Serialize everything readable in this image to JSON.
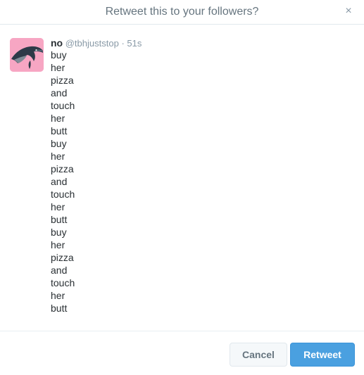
{
  "dialog": {
    "title": "Retweet this to your followers?",
    "close_icon": "×"
  },
  "tweet": {
    "fullname": "no",
    "username": "@tbhjuststop",
    "separator": "·",
    "timestamp": "51s",
    "lines": [
      "buy",
      "her",
      "pizza",
      "and",
      "touch",
      "her",
      "butt",
      "buy",
      "her",
      "pizza",
      "and",
      "touch",
      "her",
      "butt",
      "buy",
      "her",
      "pizza",
      "and",
      "touch",
      "her",
      "butt"
    ]
  },
  "footer": {
    "cancel_label": "Cancel",
    "retweet_label": "Retweet"
  },
  "colors": {
    "accent": "#4aa0e0",
    "avatar_background": "#f7a6c3"
  }
}
